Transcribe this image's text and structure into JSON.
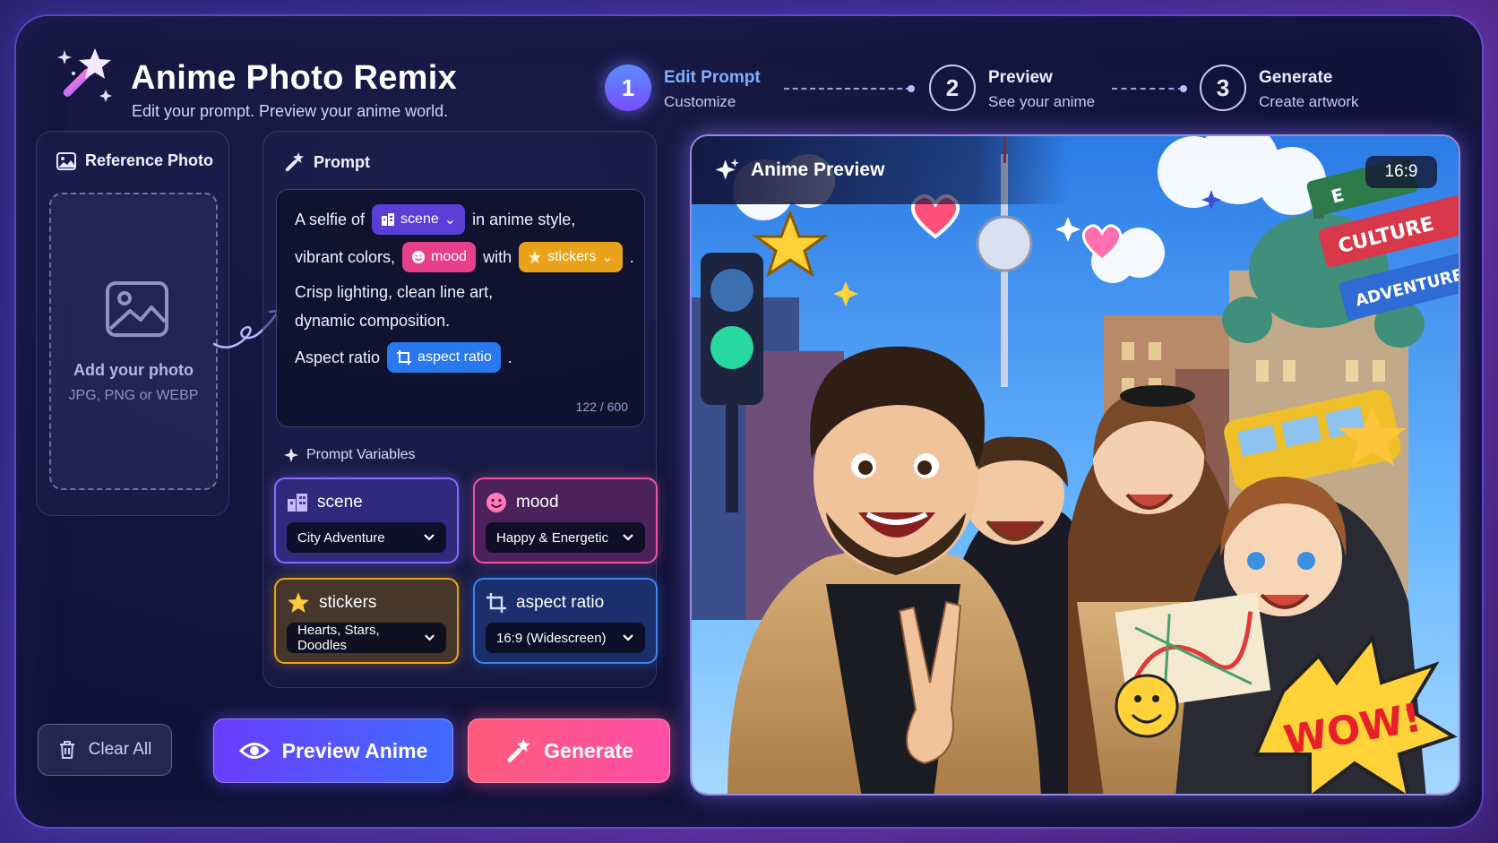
{
  "header": {
    "title": "Anime Photo Remix",
    "subtitle": "Edit your prompt. Preview your anime world."
  },
  "steps": [
    {
      "number": "1",
      "title": "Edit Prompt",
      "subtitle": "Customize",
      "active": true
    },
    {
      "number": "2",
      "title": "Preview",
      "subtitle": "See your anime",
      "active": false
    },
    {
      "number": "3",
      "title": "Generate",
      "subtitle": "Create artwork",
      "active": false
    }
  ],
  "reference": {
    "title": "Reference Photo",
    "drop_title": "Add your photo",
    "drop_formats": "JPG, PNG or WEBP"
  },
  "prompt": {
    "title": "Prompt",
    "line1_a": "A selfie of",
    "chip_scene": "scene",
    "line1_b": "in anime style,",
    "line2_a": "vibrant colors,",
    "chip_mood": "mood",
    "line2_b": "with",
    "chip_stickers": "stickers",
    "line2_c": ".",
    "line3": "Crisp lighting, clean line art,",
    "line4": "dynamic composition.",
    "line5_a": "Aspect ratio",
    "chip_aspect": "aspect ratio",
    "line5_b": ".",
    "counter": "122 / 600"
  },
  "variables": {
    "title": "Prompt Variables",
    "scene": {
      "label": "scene",
      "value": "City Adventure"
    },
    "mood": {
      "label": "mood",
      "value": "Happy & Energetic"
    },
    "stickers": {
      "label": "stickers",
      "value": "Hearts, Stars, Doodles"
    },
    "aspect": {
      "label": "aspect ratio",
      "value": "16:9 (Widescreen)"
    }
  },
  "buttons": {
    "clear": "Clear All",
    "preview": "Preview Anime",
    "generate": "Generate"
  },
  "preview": {
    "title": "Anime Preview",
    "ratio": "16:9",
    "signs": [
      "E",
      "CULTURE",
      "ADVENTURE"
    ],
    "sticker_text": "WOW!"
  },
  "colors": {
    "accent": "#7a4dff",
    "scene": "#5b3ed6",
    "mood": "#e83f8b",
    "stickers": "#e8a31b",
    "aspect": "#2a78ee",
    "generate": "#ff4fa8"
  },
  "icons": {
    "logo": "magic-wand-icon",
    "reference": "image-icon",
    "prompt": "magic-wand-icon",
    "variables": "sparkle-icon",
    "scene": "building-icon",
    "mood": "smiley-icon",
    "stickers": "star-icon",
    "aspect": "crop-icon",
    "clear": "trash-icon",
    "preview": "eye-icon",
    "generate": "magic-wand-icon"
  }
}
